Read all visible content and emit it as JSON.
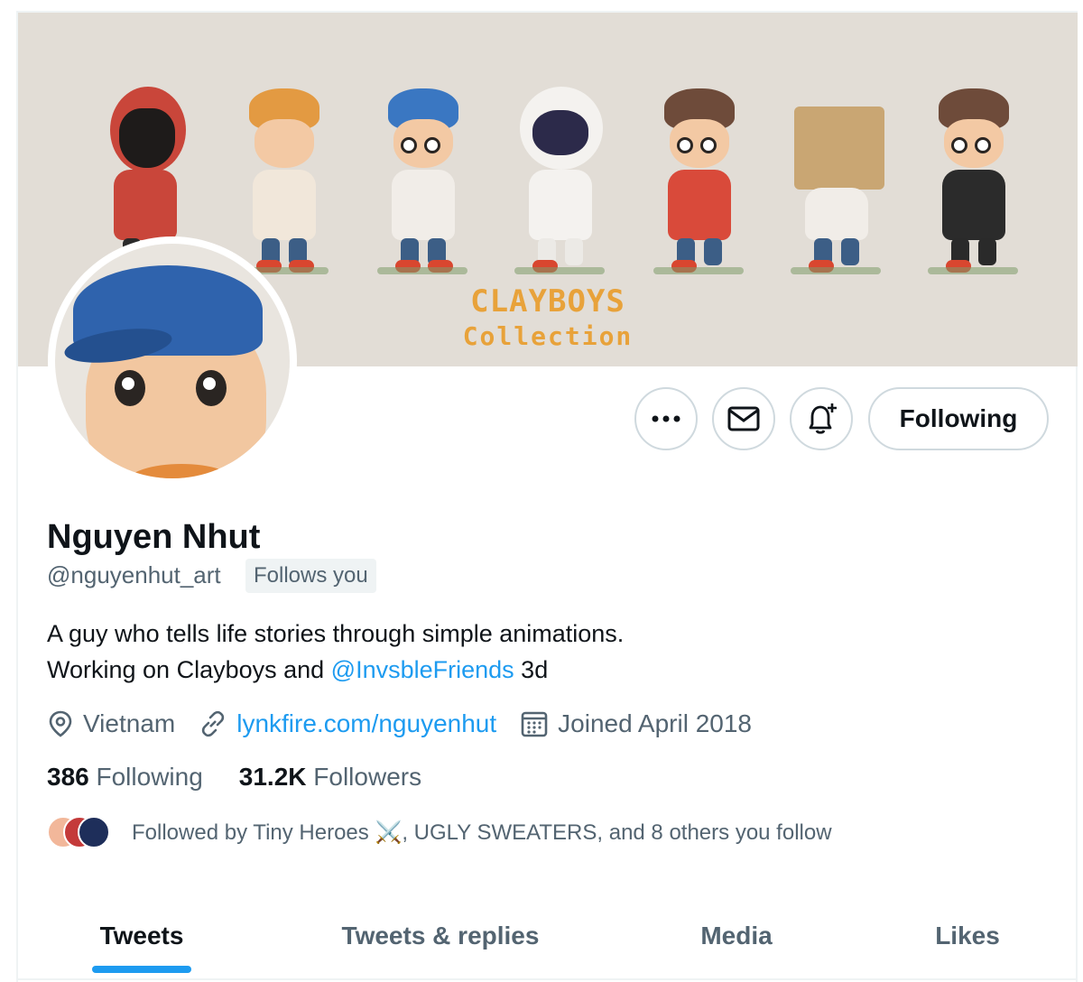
{
  "banner": {
    "brand_title": "CLAYBOYS",
    "brand_subtitle": "Collection",
    "colors": {
      "background": "#e2ddd6",
      "brand": "#e8a23a"
    }
  },
  "actions": {
    "more_icon": "more-icon",
    "message_icon": "envelope-icon",
    "notify_icon": "bell-plus-icon",
    "following_label": "Following"
  },
  "profile": {
    "name": "Nguyen Nhut",
    "handle": "@nguyenhut_art",
    "follows_you": "Follows you",
    "bio_line1": "A guy who tells life stories through simple animations.",
    "bio_line2_prefix": "Working on Clayboys and ",
    "bio_mention": "@InvsbleFriends",
    "bio_line2_suffix": " 3d",
    "location": "Vietnam",
    "website": "lynkfire.com/nguyenhut",
    "joined": "Joined April 2018"
  },
  "stats": {
    "following_count": "386",
    "following_label": " Following",
    "followers_count": "31.2K",
    "followers_label": " Followers"
  },
  "followed_by": {
    "text": "Followed by Tiny Heroes ⚔️, UGLY SWEATERS, and 8 others you follow"
  },
  "tabs": [
    {
      "label": "Tweets",
      "active": true
    },
    {
      "label": "Tweets & replies",
      "active": false
    },
    {
      "label": "Media",
      "active": false
    },
    {
      "label": "Likes",
      "active": false
    }
  ],
  "colors": {
    "accent": "#1d9bf0",
    "text": "#0f1419",
    "muted": "#536471"
  }
}
